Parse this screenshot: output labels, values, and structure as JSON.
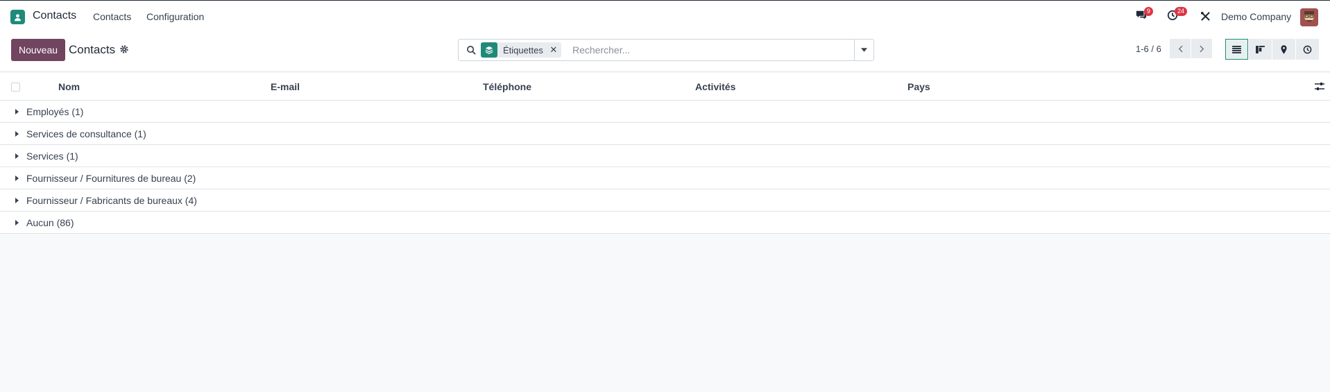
{
  "navbar": {
    "app_name": "Contacts",
    "menu": [
      "Contacts",
      "Configuration"
    ],
    "messages_count": "9",
    "activities_count": "24",
    "company": "Demo Company"
  },
  "control": {
    "new_button": "Nouveau",
    "title": "Contacts",
    "search": {
      "facet_label": "Étiquettes",
      "placeholder": "Rechercher..."
    },
    "pager": "1-6 / 6"
  },
  "list": {
    "columns": [
      "Nom",
      "E-mail",
      "Téléphone",
      "Activités",
      "Pays"
    ],
    "groups": [
      "Employés (1)",
      "Services de consultance (1)",
      "Services (1)",
      "Fournisseur / Fournitures de bureau (2)",
      "Fournisseur / Fabricants de bureaux (4)",
      "Aucun (86)"
    ]
  },
  "colors": {
    "brand": "#71445f",
    "accent": "#1f8a7a",
    "badge": "#dc3545"
  }
}
